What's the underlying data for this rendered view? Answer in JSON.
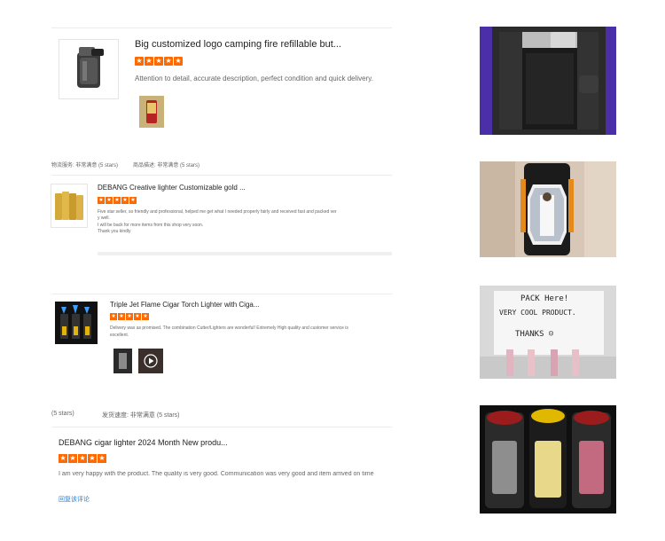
{
  "reviews": [
    {
      "title": "Big customized logo camping fire refillable but...",
      "stars": [
        "★",
        "★",
        "★",
        "★",
        "★"
      ],
      "text": "Attention to detail, accurate description, perfect condition and quick delivery."
    },
    {
      "title": "DEBANG Creative lighter Customizable gold ...",
      "stars": [
        "★",
        "★",
        "★",
        "★",
        "★"
      ],
      "text_lines": [
        "Five star seller, so friendly and professional, helped me get what I needed properly fairly and received fast and packed ver",
        "y well.",
        "I will be back for more items from this shop very soon.",
        "Thank you kindly"
      ]
    },
    {
      "title": "Triple Jet Flame Cigar Torch Lighter with Ciga...",
      "stars": [
        "★",
        "★",
        "★",
        "★",
        "★"
      ],
      "text_lines": [
        "Delivery was as promised. The combination Cutter/Lighters are wonderful! Extremely High quality and customer service is",
        "excellent."
      ]
    },
    {
      "title": "DEBANG cigar lighter 2024 Month New produ...",
      "stars": [
        "★",
        "★",
        "★",
        "★",
        "★"
      ],
      "text": "I am very happy with the product. The quality is very good. Communication was very good and item arrived on time",
      "reply_link": "回复该评论"
    }
  ],
  "meta_rows": {
    "row1": {
      "left": "物流服务: 非常满意 (5 stars)",
      "right": "商品描述: 非常满意 (5 stars)"
    },
    "row2": {
      "left": "(5 stars)",
      "right": "发货速度: 非常满意 (5 stars)"
    }
  },
  "photos": {
    "note_line1": "PACK Here!",
    "note_line2": "VERY COOL PRODUCT.",
    "note_line3": "THANKS ☺"
  },
  "colors": {
    "star": "#ff6a00",
    "link": "#2a7dd1",
    "divider": "#ececec"
  }
}
